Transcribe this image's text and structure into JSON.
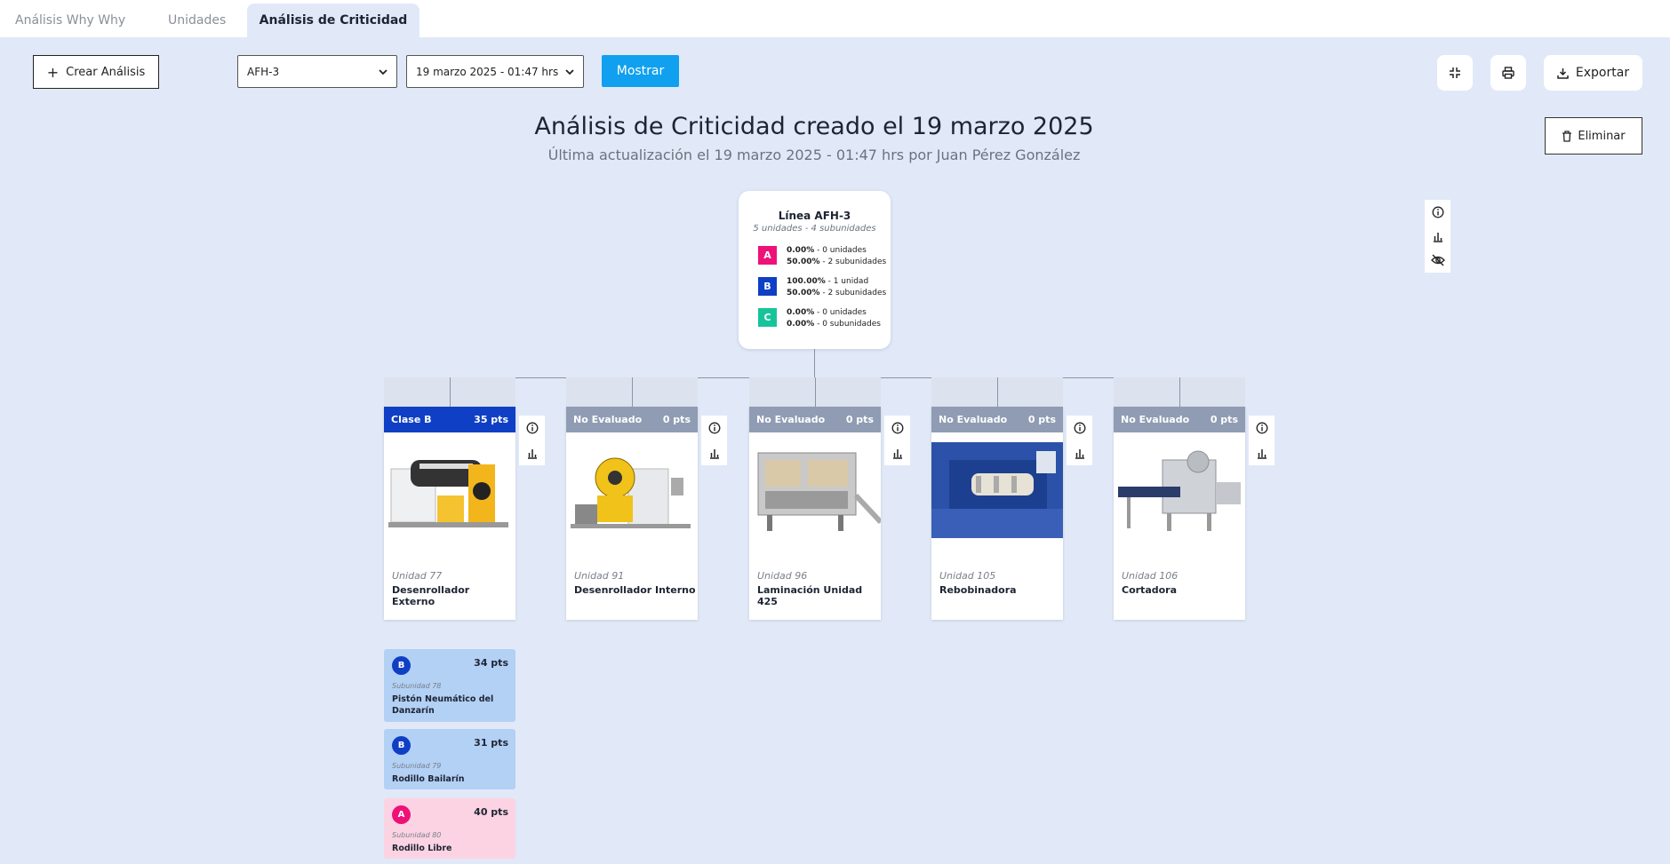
{
  "tabs": [
    {
      "label": "Análisis Why Why"
    },
    {
      "label": "Unidades"
    },
    {
      "label": "Análisis de Criticidad"
    }
  ],
  "toolbar": {
    "create_label": "Crear Análisis",
    "line_select": "AFH-3",
    "date_select": "19 marzo 2025 - 01:47 hrs",
    "show_label": "Mostrar",
    "export_label": "Exportar",
    "delete_label": "Eliminar"
  },
  "header": {
    "title": "Análisis de Criticidad creado el 19 marzo 2025",
    "subtitle": "Última actualización el 19 marzo 2025 - 01:47 hrs por Juan Pérez González"
  },
  "root": {
    "title": "Línea AFH-3",
    "subtitle": "5 unidades - 4 subunidades",
    "classes": [
      {
        "letter": "A",
        "color": "#ee1178",
        "l1_pct": "0.00%",
        "l1_txt": " - 0 unidades",
        "l2_pct": "50.00%",
        "l2_txt": " - 2 subunidades"
      },
      {
        "letter": "B",
        "color": "#0f3fc4",
        "l1_pct": "100.00%",
        "l1_txt": " - 1 unidad",
        "l2_pct": "50.00%",
        "l2_txt": " - 2 subunidades"
      },
      {
        "letter": "C",
        "color": "#17c49a",
        "l1_pct": "0.00%",
        "l1_txt": " - 0 unidades",
        "l2_pct": "0.00%",
        "l2_txt": " - 0 subunidades"
      }
    ]
  },
  "units": [
    {
      "status": "Clase B",
      "points": "35 pts",
      "color": "#0f3fc4",
      "label": "Unidad 77",
      "name": "Desenrollador Externo"
    },
    {
      "status": "No Evaluado",
      "points": "0 pts",
      "color": "#8f9cb3",
      "label": "Unidad 91",
      "name": "Desenrollador Interno"
    },
    {
      "status": "No Evaluado",
      "points": "0 pts",
      "color": "#8f9cb3",
      "label": "Unidad 96",
      "name": "Laminación Unidad 425"
    },
    {
      "status": "No Evaluado",
      "points": "0 pts",
      "color": "#8f9cb3",
      "label": "Unidad 105",
      "name": "Rebobinadora"
    },
    {
      "status": "No Evaluado",
      "points": "0 pts",
      "color": "#8f9cb3",
      "label": "Unidad 106",
      "name": "Cortadora"
    }
  ],
  "subunits": [
    {
      "letter": "B",
      "points": "34 pts",
      "label": "Subunidad 78",
      "name": "Pistón Neumático del Danzarín",
      "bg": "#b3d0f5",
      "badge": "#0f3fc4"
    },
    {
      "letter": "B",
      "points": "31 pts",
      "label": "Subunidad 79",
      "name": "Rodillo Bailarín",
      "bg": "#b3d0f5",
      "badge": "#0f3fc4"
    },
    {
      "letter": "A",
      "points": "40 pts",
      "label": "Subunidad 80",
      "name": "Rodillo Libre",
      "bg": "#fcd3e2",
      "badge": "#ee1178"
    }
  ]
}
